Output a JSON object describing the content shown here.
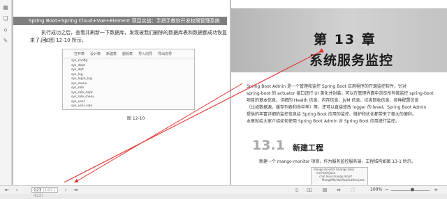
{
  "left_page": {
    "header": "Spring Boot+Spring Cloud+Vue+Element 项目实战：手把手教你开发权限管理系统",
    "para_line1": "执行成功之后，查看并刷新一下数据库，发现被我们删除的数据库表和数据都成功恢复回",
    "para_line2": "来了，如图 12-10 所示。",
    "dialog_toolbar": [
      "打开表",
      "设计表",
      "新建表",
      "删除表",
      "导入向导",
      "导出向导"
    ],
    "tables": [
      "sys_config",
      "sys_dept",
      "sys_dict",
      "sys_log",
      "sys_login_log",
      "sys_menu",
      "sys_role",
      "sys_role_dept",
      "sys_role_menu",
      "sys_user",
      "sys_user_role"
    ],
    "caption": "图 12-10"
  },
  "right_page": {
    "chapter_number": "第 13 章",
    "chapter_title": "系统服务监控",
    "intro_lines": [
      "Spring Boot Admin 是一个管理和监控 Spring Boot 应用程序的开源监控软件，针对",
      "spring-boot 的 actuator 接口进行 UI 美化并封装，可以在管理界面中浏览所有被监控 spring-boot",
      "项目的基本信息、详细的 Health 信息、内存信息、JVM 信息、垃圾回收信息、各种配置信息",
      "（比如数据源、缓存列表和命中率）等，还可以直接修改 logger 的 level。Spring Boot Admin",
      "提供的丰富详细的监控信息给 Spring Boot 应用的监控、维护和优化都带来了极大的便利。",
      "本章就给大家介绍如何使用 Spring Boot Admin 对 Spring Boot 应用进行监控。"
    ],
    "section_number": "13.1",
    "section_title": "新建工程",
    "section_text": "新建一个 mango-monitor 项目，作为服务监控服务端，工程结构如图 13-1 所示。",
    "tree_rows": [
      "mango-monitor [mango dev]",
      "src/main/java",
      "com.louis.mango.monit",
      "MangoMonitorApplication.java"
    ]
  },
  "status_bar": {
    "page_value": "123",
    "page_total": "(147 / 422)",
    "zoom": "100%"
  },
  "annotation": {
    "color": "#e53935"
  }
}
